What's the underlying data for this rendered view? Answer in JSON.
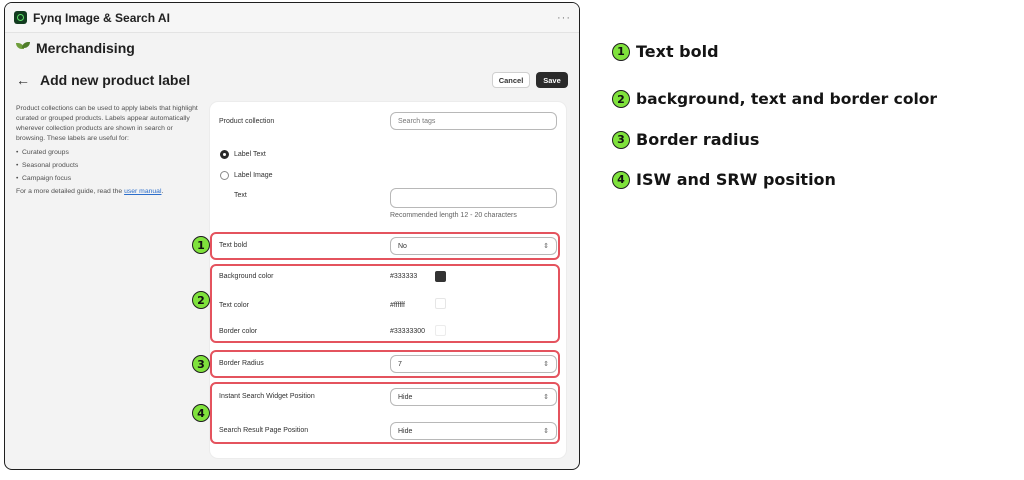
{
  "app": {
    "title": "Fynq Image & Search AI",
    "more": "···"
  },
  "section": {
    "title": "Merchandising",
    "icon": "leaf-icon"
  },
  "page": {
    "title": "Add new product label",
    "back_icon": "←"
  },
  "actions": {
    "cancel": "Cancel",
    "save": "Save"
  },
  "description": {
    "p1": "Product collections can be used to apply labels that highlight curated or grouped products. Labels appear automatically wherever collection products are shown in search or browsing. These labels are useful for:",
    "bullets": [
      "Curated groups",
      "Seasonal products",
      "Campaign focus"
    ],
    "p2_prefix": "For a more detailed guide, read the ",
    "link": "user manual",
    "p2_suffix": "."
  },
  "form": {
    "product_collection_label": "Product collection",
    "product_collection_placeholder": "Search tags",
    "label_text_option": "Label Text",
    "label_image_option": "Label Image",
    "text_label": "Text",
    "text_value": "",
    "text_hint": "Recommended length 12 - 20 characters",
    "text_bold_label": "Text bold",
    "text_bold_value": "No",
    "bg_color_label": "Background color",
    "bg_color_value": "#333333",
    "text_color_label": "Text color",
    "text_color_value": "#ffffff",
    "border_color_label": "Border color",
    "border_color_value": "#33333300",
    "border_radius_label": "Border Radius",
    "border_radius_value": "7",
    "isw_label": "Instant Search Widget Position",
    "isw_value": "Hide",
    "srp_label": "Search Result Page Position",
    "srp_value": "Hide"
  },
  "legend": [
    {
      "num": "1",
      "text": "Text bold"
    },
    {
      "num": "2",
      "text": "background, text and border color"
    },
    {
      "num": "3",
      "text": "Border radius"
    },
    {
      "num": "4",
      "text": "ISW and SRW position"
    }
  ],
  "colors": {
    "highlight": "#e4535e",
    "badge": "#7fe23c",
    "swatch_bg": "#333333",
    "swatch_text": "#ffffff"
  }
}
